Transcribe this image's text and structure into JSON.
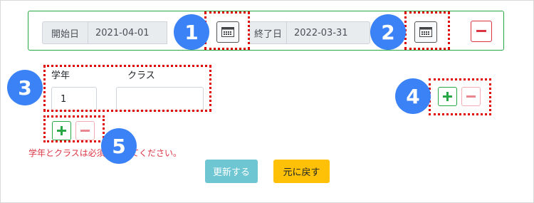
{
  "period": {
    "start_label": "開始日",
    "start_value": "2021-04-01",
    "end_label": "終了日",
    "end_value": "2022-03-31"
  },
  "class_form": {
    "grade_label": "学年",
    "grade_value": "1",
    "class_label": "クラス",
    "class_value": ""
  },
  "error_message": "学年とクラスは必須入力してください。",
  "buttons": {
    "update_label": "更新する",
    "back_label": "元に戻す"
  },
  "annotations": [
    "1",
    "2",
    "3",
    "4",
    "5"
  ],
  "colors": {
    "success": "#28a745",
    "danger": "#dc3545",
    "info": "#6ec6d3",
    "warning": "#ffc107",
    "annotation_badge": "#3b82f6",
    "annotation_outline": "#e00000"
  },
  "icons": {
    "calendar": "calendar-icon",
    "plus": "plus-icon",
    "minus": "minus-icon"
  }
}
